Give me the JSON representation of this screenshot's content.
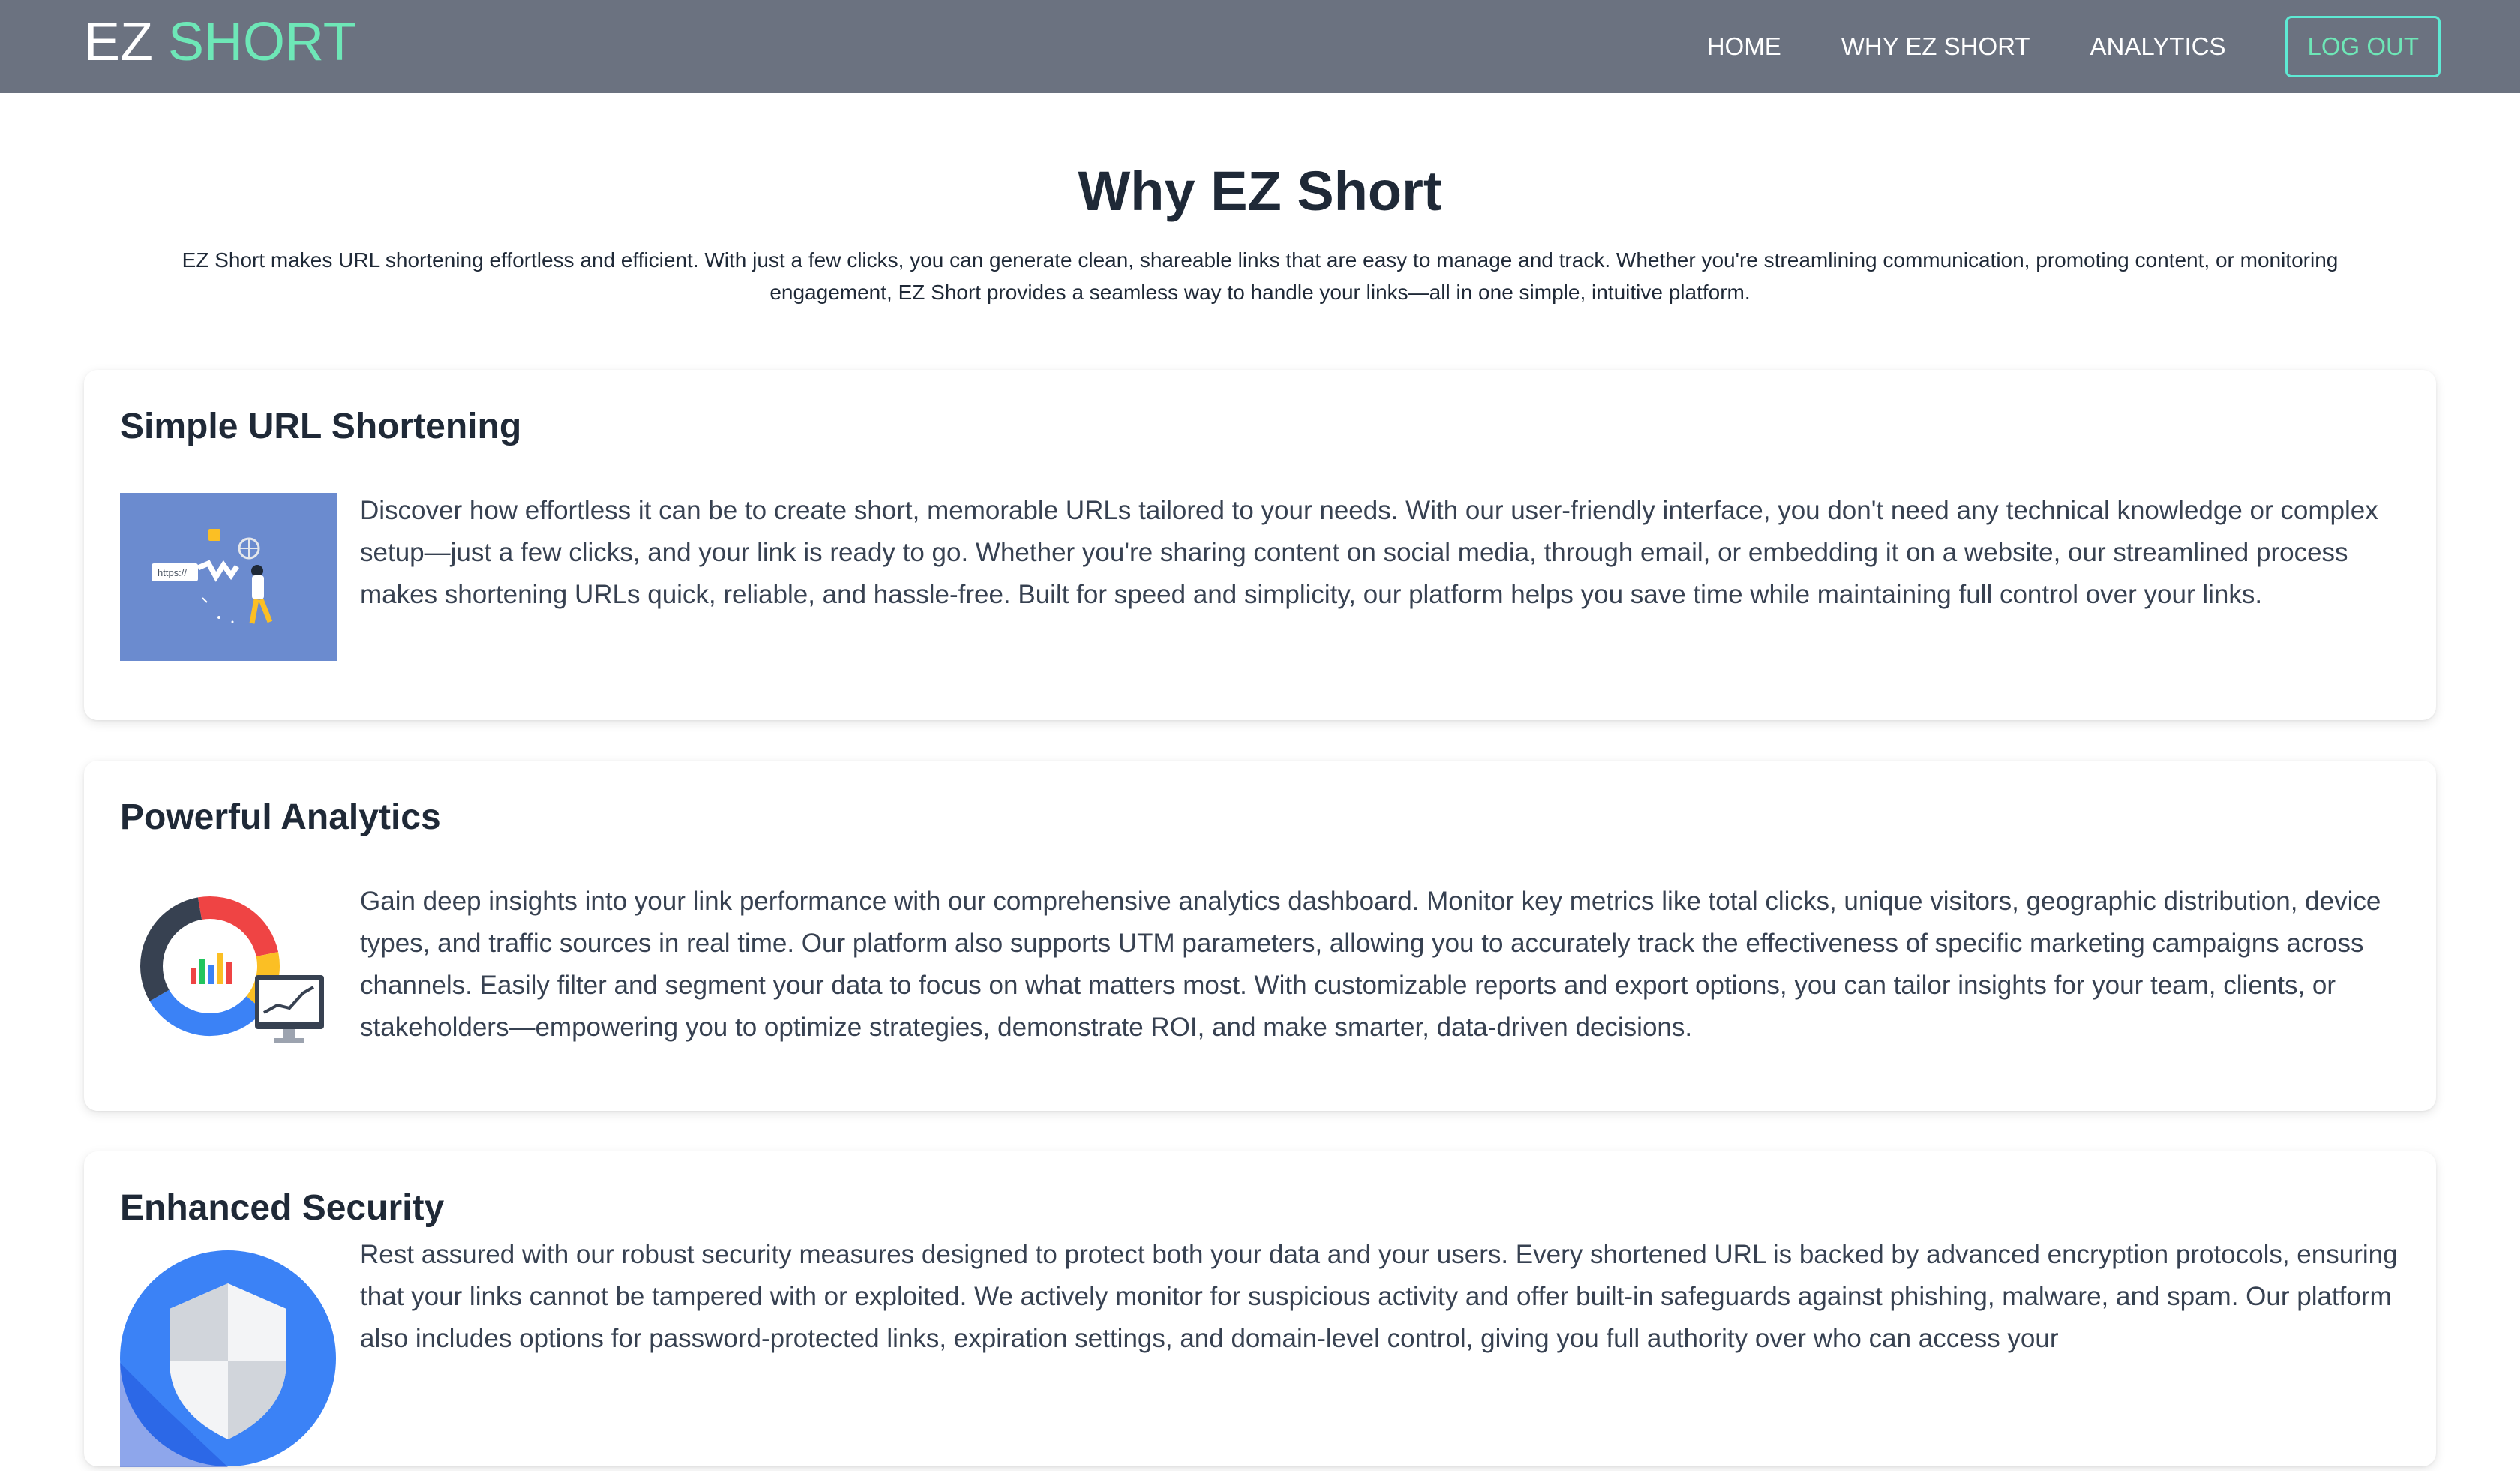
{
  "nav": {
    "brand_part1": "EZ",
    "brand_part2": "SHORT",
    "links": [
      "HOME",
      "WHY EZ SHORT",
      "ANALYTICS"
    ],
    "logout_label": "LOG OUT"
  },
  "page": {
    "title": "Why EZ Short",
    "intro": "EZ Short makes URL shortening effortless and efficient. With just a few clicks, you can generate clean, shareable links that are easy to manage and track. Whether you're streamlining communication, promoting content, or monitoring engagement, EZ Short provides a seamless way to handle your links—all in one simple, intuitive platform."
  },
  "features": [
    {
      "title": "Simple URL Shortening",
      "body": "Discover how effortless it can be to create short, memorable URLs tailored to your needs. With our user-friendly interface, you don't need any technical knowledge or complex setup—just a few clicks, and your link is ready to go. Whether you're sharing content on social media, through email, or embedding it on a website, our streamlined process makes shortening URLs quick, reliable, and hassle-free. Built for speed and simplicity, our platform helps you save time while maintaining full control over your links.",
      "image_text": "https://"
    },
    {
      "title": "Powerful Analytics",
      "body": "Gain deep insights into your link performance with our comprehensive analytics dashboard. Monitor key metrics like total clicks, unique visitors, geographic distribution, device types, and traffic sources in real time. Our platform also supports UTM parameters, allowing you to accurately track the effectiveness of specific marketing campaigns across channels. Easily filter and segment your data to focus on what matters most. With customizable reports and export options, you can tailor insights for your team, clients, or stakeholders—empowering you to optimize strategies, demonstrate ROI, and make smarter, data-driven decisions."
    },
    {
      "title": "Enhanced Security",
      "body": "Rest assured with our robust security measures designed to protect both your data and your users. Every shortened URL is backed by advanced encryption protocols, ensuring that your links cannot be tampered with or exploited. We actively monitor for suspicious activity and offer built-in safeguards against phishing, malware, and spam. Our platform also includes options for password-protected links, expiration settings, and domain-level control, giving you full authority over who can access your"
    }
  ],
  "colors": {
    "navbar": "#6b7280",
    "brand_accent": "#6ee7b7",
    "text": "#1f2937",
    "illustration_bg": "#6b8bcf",
    "shield_blue": "#3b82f6"
  }
}
